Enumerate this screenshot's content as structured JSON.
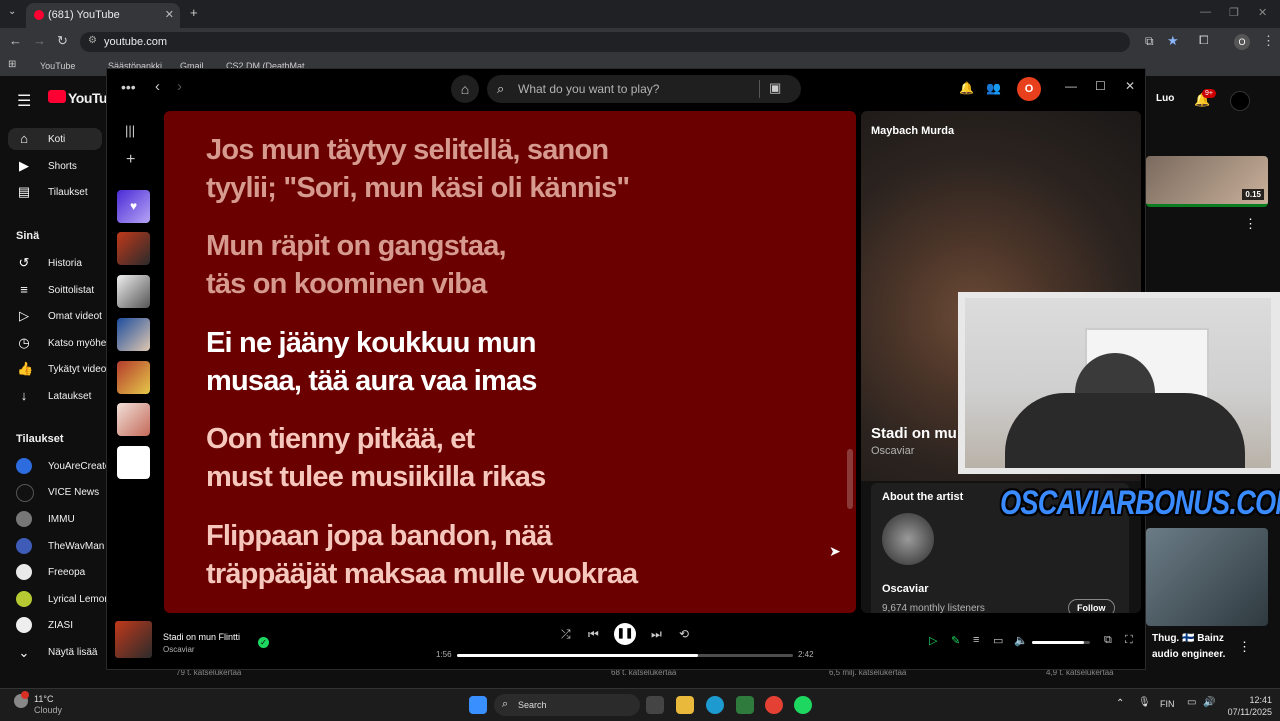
{
  "browser": {
    "tab_title": "(681) YouTube",
    "url": "youtube.com",
    "bookmarks": [
      "YouTube",
      "Säästöpankki",
      "Gmail",
      "CS2 DM (DeathMat"
    ],
    "profile_initial": "O"
  },
  "youtube": {
    "logo": "YouTube",
    "nav": [
      {
        "label": "Koti",
        "icon": "home-icon"
      },
      {
        "label": "Shorts",
        "icon": "shorts-icon"
      },
      {
        "label": "Tilaukset",
        "icon": "subscriptions-icon"
      }
    ],
    "you_section": "Sinä",
    "you_items": [
      "Historia",
      "Soittolistat",
      "Omat videot",
      "Katso myöhe",
      "Tykätyt videot",
      "Lataukset"
    ],
    "subs_section": "Tilaukset",
    "channels": [
      "YouAreCreato",
      "VICE News",
      "IMMU",
      "TheWavMan",
      "Freeopa",
      "Lyrical Lemon",
      "ZIASI",
      "Näytä lisää"
    ],
    "right_labels": {
      "create": "Luo",
      "notif_badge": "9+",
      "duration": "0.15",
      "snippet_line1": "Thug. 🇫🇮 Bainz",
      "snippet_line2": "audio engineer."
    },
    "bottom_meta": [
      "79 t. katselukertaa",
      "68 t. katselukertaa",
      "6,5 milj. katselukertaa",
      "4,9 t. katselukertaa"
    ]
  },
  "spotify": {
    "search_placeholder": "What do you want to play?",
    "avatar_initial": "O",
    "lyrics": [
      {
        "line1": "Jos mun täytyy selitellä, sanon",
        "line2": "tyylii; \"Sori, mun käsi oli kännis\"",
        "state": "past"
      },
      {
        "line1": "Mun räpit on gangstaa,",
        "line2": "täs on koominen viba",
        "state": "past"
      },
      {
        "line1": "Ei ne jääny koukkuu mun",
        "line2": "musaa, tää aura vaa imas",
        "state": "current"
      },
      {
        "line1": "Oon tienny pitkää, et",
        "line2": "must tulee musiikilla rikas",
        "state": "next"
      },
      {
        "line1": "Flippaan jopa bandon, nää",
        "line2": "träppääjät maksaa mulle vuokraa",
        "state": "next"
      }
    ],
    "now_playing_panel": {
      "header": "Maybach Murda",
      "song_title": "Stadi on mu",
      "artist": "Oscaviar",
      "about_label": "About the artist",
      "artist_name": "Oscaviar",
      "listeners": "9,674 monthly listeners",
      "follow_label": "Follow"
    },
    "player": {
      "track": "Stadi on mun Flintti",
      "artist": "Oscaviar",
      "elapsed": "1:56",
      "duration": "2:42",
      "progress_fraction": 0.716,
      "volume_fraction": 0.9
    }
  },
  "overlay": {
    "watermark": "OSCAVIARBONUS.COM"
  },
  "taskbar": {
    "weather_temp": "11°C",
    "weather_desc": "Cloudy",
    "search_label": "Search",
    "lang": "FIN",
    "time": "12:41",
    "date": "07/11/2025"
  },
  "colors": {
    "lyrics_bg": "#6a0000",
    "spotify_green": "#1ed760",
    "youtube_red": "#ff0033",
    "watermark_blue": "#3a8bff"
  }
}
